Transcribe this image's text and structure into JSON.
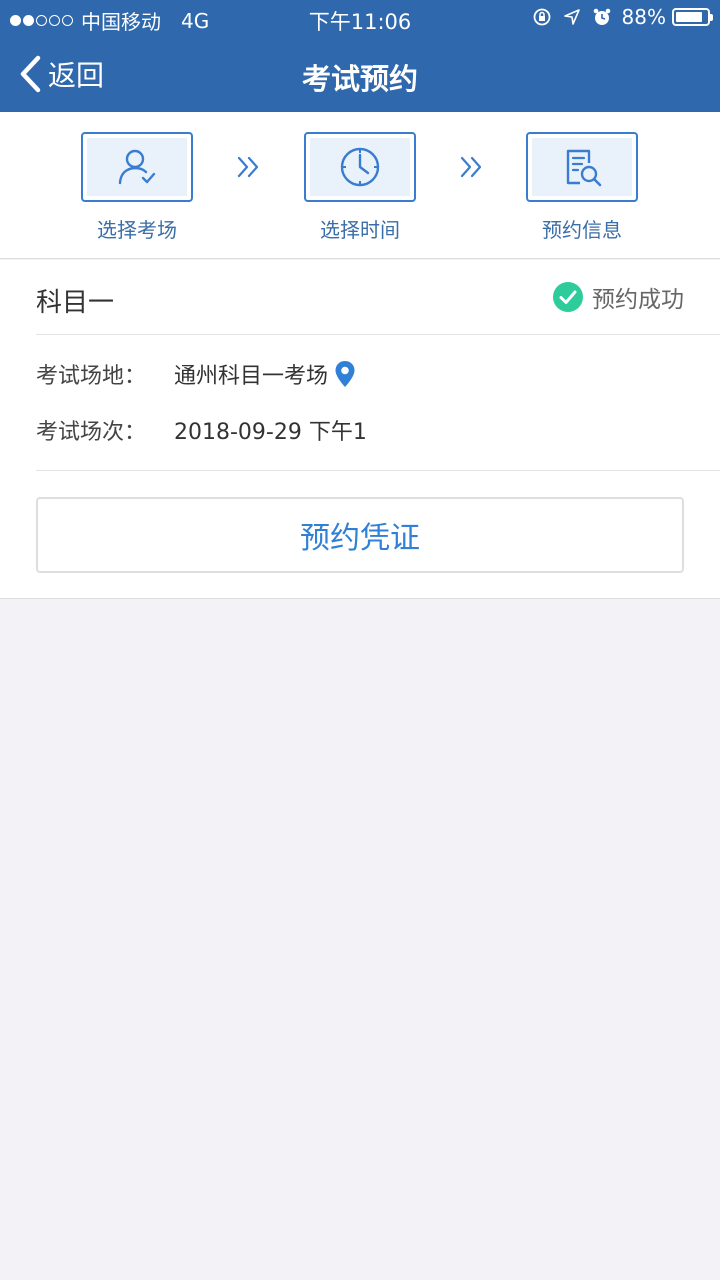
{
  "status_bar": {
    "carrier": "中国移动",
    "network": "4G",
    "time": "下午11:06",
    "battery": "88%",
    "battery_level": 0.88,
    "signal_bars": 2,
    "signal_total": 5
  },
  "nav": {
    "back_label": "返回",
    "title": "考试预约"
  },
  "steps": [
    {
      "label": "选择考场",
      "icon": "user-check-icon"
    },
    {
      "label": "选择时间",
      "icon": "clock-icon"
    },
    {
      "label": "预约信息",
      "icon": "document-search-icon"
    }
  ],
  "booking": {
    "subject": "科目一",
    "status": "预约成功",
    "venue_label": "考试场地：",
    "venue_value": "通州科目一考场",
    "session_label": "考试场次：",
    "session_value": "2018-09-29 下午1",
    "voucher_button": "预约凭证"
  },
  "colors": {
    "header": "#2f68ad",
    "accent": "#3a7ccf",
    "success": "#2ecc9a",
    "link": "#2f80d6",
    "page_bg": "#f3f3f7"
  }
}
